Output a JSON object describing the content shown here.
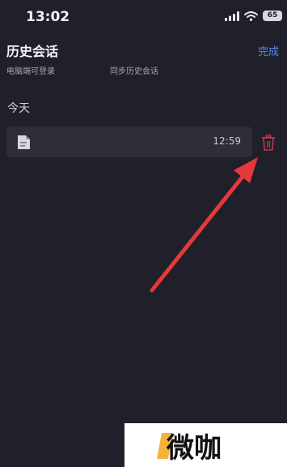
{
  "status": {
    "time": "13:02",
    "battery": "65"
  },
  "header": {
    "title": "历史会话",
    "done_label": "完成",
    "subtitle_left": "电脑端可登录",
    "subtitle_right": "同步历史会话"
  },
  "section": {
    "label": "今天"
  },
  "items": [
    {
      "time": "12:59"
    }
  ],
  "watermark": {
    "text": "微咖"
  },
  "colors": {
    "background": "#20202a",
    "row": "#2e2e38",
    "accent": "#5a86e8",
    "delete": "#c0394a",
    "arrow": "#e5383b"
  },
  "icons": {
    "signal": "signal-icon",
    "wifi": "wifi-icon",
    "battery": "battery-icon",
    "document": "document-icon",
    "delete": "trash-icon"
  }
}
